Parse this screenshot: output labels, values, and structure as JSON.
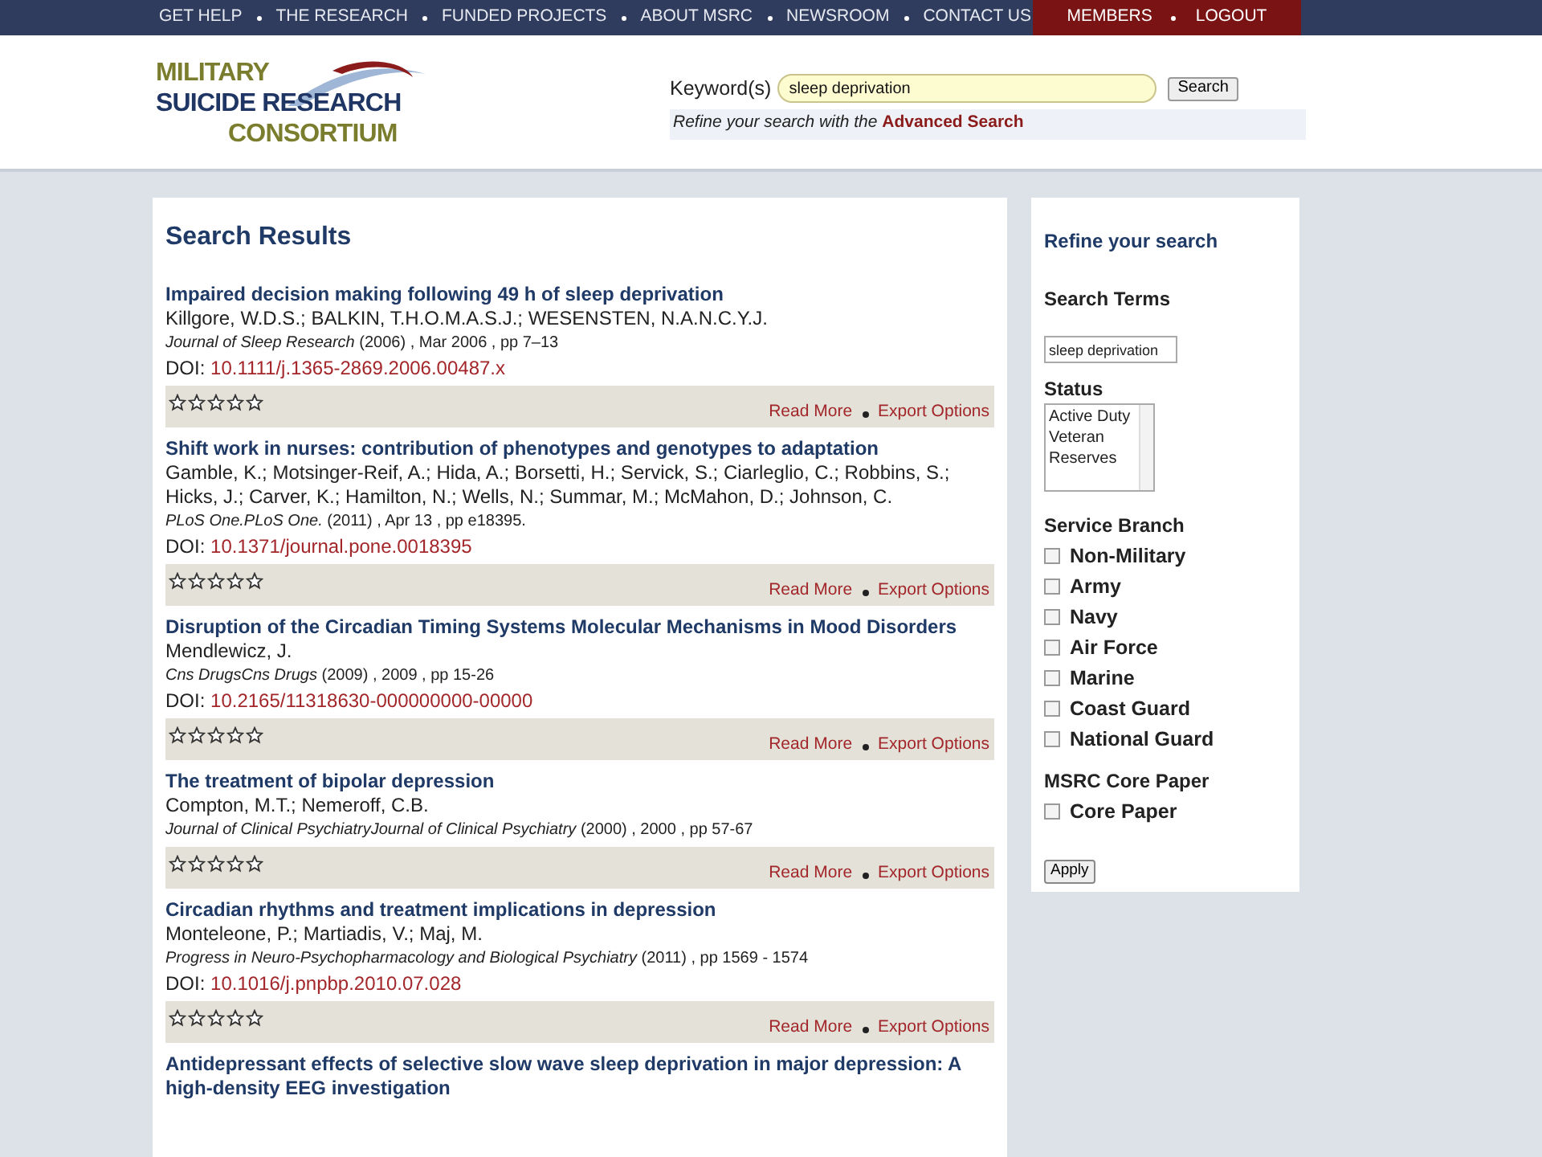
{
  "nav": {
    "items": [
      "GET HELP",
      "THE RESEARCH",
      "FUNDED PROJECTS",
      "ABOUT MSRC",
      "NEWSROOM",
      "CONTACT US"
    ],
    "members": [
      "MEMBERS",
      "LOGOUT"
    ]
  },
  "logo": {
    "lines": [
      "MILITARY",
      "SUICIDE RESEARCH",
      "CONSORTIUM"
    ]
  },
  "search": {
    "label": "Keyword(s)",
    "value": "sleep deprivation",
    "button": "Search",
    "refine_text": "Refine your search with the",
    "refine_link": "Advanced Search"
  },
  "results": {
    "title": "Search Results",
    "items": [
      {
        "title": "Impaired decision making following 49 h of sleep deprivation",
        "authors": "Killgore, W.D.S.; BALKIN, T.H.O.M.A.S.J.; WESENSTEN, N.A.N.C.Y.J.",
        "journal": "Journal of Sleep Research",
        "details": "(2006) , Mar 2006 , pp 7–13",
        "doi_label": "DOI:",
        "doi": "10.1111/j.1365-2869.2006.00487.x",
        "stars": 0,
        "read_more": "Read More",
        "export": "Export Options"
      },
      {
        "title": "Shift work in nurses: contribution of phenotypes and genotypes to adaptation",
        "authors": "Gamble, K.; Motsinger-Reif, A.; Hida, A.; Borsetti, H.; Servick, S.; Ciarleglio, C.; Robbins, S.; Hicks, J.; Carver, K.; Hamilton, N.; Wells, N.; Summar, M.; McMahon, D.; Johnson, C.",
        "journal": "PLoS One.PLoS One.",
        "details": "(2011) , Apr 13 , pp e18395.",
        "doi_label": "DOI:",
        "doi": "10.1371/journal.pone.0018395",
        "stars": 0,
        "read_more": "Read More",
        "export": "Export Options"
      },
      {
        "title": "Disruption of the Circadian Timing Systems Molecular Mechanisms in Mood Disorders",
        "authors": "Mendlewicz, J.",
        "journal": "Cns DrugsCns Drugs",
        "details": "(2009) , 2009 , pp 15-26",
        "doi_label": "DOI:",
        "doi": "10.2165/11318630-000000000-00000",
        "stars": 0,
        "read_more": "Read More",
        "export": "Export Options"
      },
      {
        "title": "The treatment of bipolar depression",
        "authors": "Compton, M.T.; Nemeroff, C.B.",
        "journal": "Journal of Clinical PsychiatryJournal of Clinical Psychiatry",
        "details": "(2000) , 2000 , pp 57-67",
        "stars": 0,
        "read_more": "Read More",
        "export": "Export Options"
      },
      {
        "title": "Circadian rhythms and treatment implications in depression",
        "authors": "Monteleone, P.; Martiadis, V.; Maj, M.",
        "journal": "Progress in Neuro-Psychopharmacology and Biological Psychiatry",
        "details": "(2011) , pp 1569 - 1574",
        "doi_label": "DOI:",
        "doi": "10.1016/j.pnpbp.2010.07.028",
        "stars": 0,
        "read_more": "Read More",
        "export": "Export Options"
      },
      {
        "title": "Antidepressant effects of selective slow wave sleep deprivation in major depression: A high-density EEG investigation"
      }
    ]
  },
  "sidebar": {
    "title": "Refine your search",
    "search_terms_label": "Search Terms",
    "search_terms_value": "sleep deprivation",
    "status_label": "Status",
    "status_options": [
      "Active Duty",
      "Veteran",
      "Reserves"
    ],
    "branch_label": "Service Branch",
    "branches": [
      {
        "label": "Non-Military",
        "checked": false
      },
      {
        "label": "Army",
        "checked": false
      },
      {
        "label": "Navy",
        "checked": false
      },
      {
        "label": "Air Force",
        "checked": false
      },
      {
        "label": "Marine",
        "checked": false
      },
      {
        "label": "Coast Guard",
        "checked": false
      },
      {
        "label": "National Guard",
        "checked": false
      }
    ],
    "core_label": "MSRC Core Paper",
    "core": [
      {
        "label": "Core Paper",
        "checked": false
      }
    ],
    "apply": "Apply"
  }
}
